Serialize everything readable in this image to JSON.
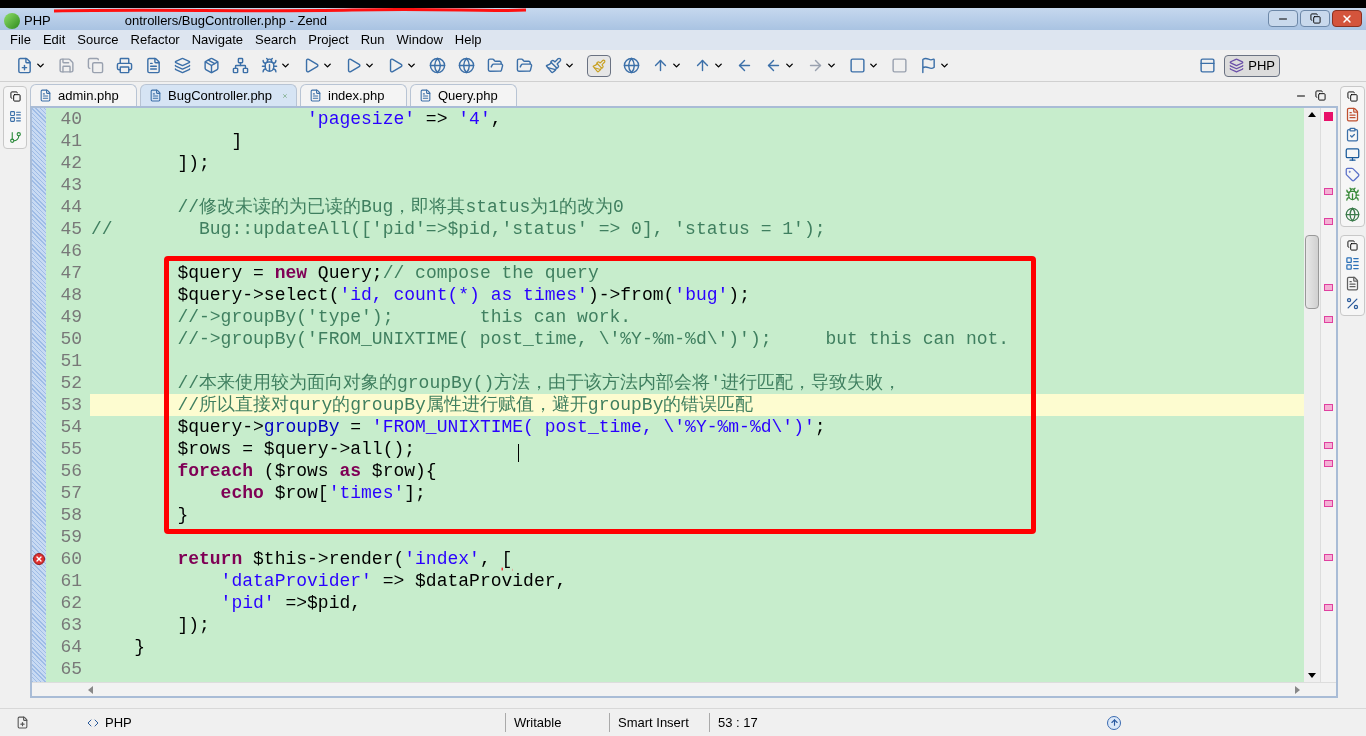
{
  "window": {
    "title": "PHP",
    "title_fragment": "ontrollers/BugController.php - Zend"
  },
  "menu": [
    "File",
    "Edit",
    "Source",
    "Refactor",
    "Navigate",
    "Search",
    "Project",
    "Run",
    "Window",
    "Help"
  ],
  "perspective": {
    "label": "PHP",
    "selected": true
  },
  "tabs": [
    {
      "label": "admin.php",
      "selected": false
    },
    {
      "label": "BugController.php",
      "selected": true
    },
    {
      "label": "index.php",
      "selected": false
    },
    {
      "label": "Query.php",
      "selected": false
    }
  ],
  "editor": {
    "blocks": [
      {
        "kind": "plain",
        "lines": [
          {
            "number": "40",
            "current": false,
            "error": false,
            "tokens": [
              {
                "kind": "string",
                "text": "                    'pagesize'"
              },
              {
                "kind": "plain",
                "text": " => "
              },
              {
                "kind": "string",
                "text": "'4'"
              },
              {
                "kind": "plain",
                "text": ","
              }
            ]
          },
          {
            "number": "41",
            "current": false,
            "error": false,
            "tokens": [
              {
                "kind": "plain",
                "text": "             ]"
              }
            ]
          },
          {
            "number": "42",
            "current": false,
            "error": false,
            "tokens": [
              {
                "kind": "plain",
                "text": "        ]);"
              }
            ]
          },
          {
            "number": "43",
            "current": false,
            "error": false
          },
          {
            "number": "44",
            "current": false,
            "error": false,
            "tokens": [
              {
                "kind": "comment",
                "text": "        //修改未读的为已读的Bug，即将其status为1的改为0"
              }
            ]
          },
          {
            "number": "45",
            "current": false,
            "error": false,
            "tokens": [
              {
                "kind": "comment",
                "text": "//        Bug::updateAll(['pid'=>$pid,'status' => 0], 'status = 1');"
              }
            ]
          },
          {
            "number": "46",
            "current": false,
            "error": false
          }
        ]
      },
      {
        "kind": "framed",
        "lines": [
          {
            "number": "47",
            "current": false,
            "error": false,
            "tokens": [
              {
                "kind": "plain",
                "text": "        $query = "
              },
              {
                "kind": "keyword",
                "text": "new"
              },
              {
                "kind": "plain",
                "text": " Query;"
              },
              {
                "kind": "comment",
                "text": "// compose the query"
              }
            ]
          },
          {
            "number": "48",
            "current": false,
            "error": false,
            "tokens": [
              {
                "kind": "plain",
                "text": "        $query->select("
              },
              {
                "kind": "string",
                "text": "'id, count(*) as times'"
              },
              {
                "kind": "plain",
                "text": ")->from("
              },
              {
                "kind": "string",
                "text": "'bug'"
              },
              {
                "kind": "plain",
                "text": ");"
              }
            ]
          },
          {
            "number": "49",
            "current": false,
            "error": false,
            "tokens": [
              {
                "kind": "comment",
                "text": "        //->groupBy('type');        this can work."
              }
            ]
          },
          {
            "number": "50",
            "current": false,
            "error": false,
            "tokens": [
              {
                "kind": "comment",
                "text": "        //->groupBy('FROM_UNIXTIME( post_time, \\'%Y-%m-%d\\')');     but this can not."
              }
            ]
          },
          {
            "number": "51",
            "current": false,
            "error": false
          },
          {
            "number": "52",
            "current": false,
            "error": false,
            "tokens": [
              {
                "kind": "comment",
                "text": "        //本来使用较为面向对象的groupBy()方法，由于该方法内部会将'进行匹配，导致失败，"
              }
            ]
          },
          {
            "number": "53",
            "current": true,
            "error": false,
            "tokens": [
              {
                "kind": "comment",
                "text": "        //所以直接对qury的groupBy属性进行赋值，避开groupBy的错误匹配"
              }
            ]
          },
          {
            "number": "54",
            "current": false,
            "error": false,
            "tokens": [
              {
                "kind": "plain",
                "text": "        $query->"
              },
              {
                "kind": "field",
                "text": "groupBy"
              },
              {
                "kind": "plain",
                "text": " = "
              },
              {
                "kind": "string",
                "text": "'FROM_UNIXTIME( post_time, \\'%Y-%m-%d\\')'"
              },
              {
                "kind": "plain",
                "text": ";"
              }
            ]
          },
          {
            "number": "55",
            "current": false,
            "error": false,
            "tokens": [
              {
                "kind": "plain",
                "text": "        $rows = $query->all();"
              }
            ]
          },
          {
            "number": "56",
            "current": false,
            "error": false,
            "tokens": [
              {
                "kind": "keyword",
                "text": "        foreach"
              },
              {
                "kind": "plain",
                "text": " ($rows "
              },
              {
                "kind": "keyword",
                "text": "as"
              },
              {
                "kind": "plain",
                "text": " $row){"
              }
            ]
          },
          {
            "number": "57",
            "current": false,
            "error": false,
            "tokens": [
              {
                "kind": "keyword",
                "text": "            echo"
              },
              {
                "kind": "plain",
                "text": " $row["
              },
              {
                "kind": "string",
                "text": "'times'"
              },
              {
                "kind": "plain",
                "text": "];"
              }
            ]
          },
          {
            "number": "58",
            "current": false,
            "error": false,
            "tokens": [
              {
                "kind": "plain",
                "text": "        }"
              }
            ]
          }
        ]
      },
      {
        "kind": "plain",
        "lines": [
          {
            "number": "59",
            "current": false,
            "error": false
          },
          {
            "number": "60",
            "current": false,
            "error": true,
            "tokens": [
              {
                "kind": "keyword",
                "text": "        return"
              },
              {
                "kind": "plain",
                "text": " $this->render("
              },
              {
                "kind": "string",
                "text": "'index'"
              },
              {
                "kind": "plain",
                "text": ", "
              },
              {
                "kind": "error",
                "text": "["
              }
            ]
          },
          {
            "number": "61",
            "current": false,
            "error": false,
            "tokens": [
              {
                "kind": "string",
                "text": "            'dataProvider'"
              },
              {
                "kind": "plain",
                "text": " => $dataProvider,"
              }
            ]
          },
          {
            "number": "62",
            "current": false,
            "error": false,
            "tokens": [
              {
                "kind": "string",
                "text": "            'pid'"
              },
              {
                "kind": "plain",
                "text": " =>$pid,"
              }
            ]
          },
          {
            "number": "63",
            "current": false,
            "error": false,
            "tokens": [
              {
                "kind": "plain",
                "text": "        ]);"
              }
            ]
          },
          {
            "number": "64",
            "current": false,
            "error": false,
            "tokens": [
              {
                "kind": "plain",
                "text": "    }"
              }
            ]
          },
          {
            "number": "65",
            "current": false,
            "error": false
          }
        ]
      }
    ]
  },
  "status_bar": {
    "language": "PHP",
    "mode": "Writable",
    "insert": "Smart Insert",
    "position": "53 : 17"
  }
}
